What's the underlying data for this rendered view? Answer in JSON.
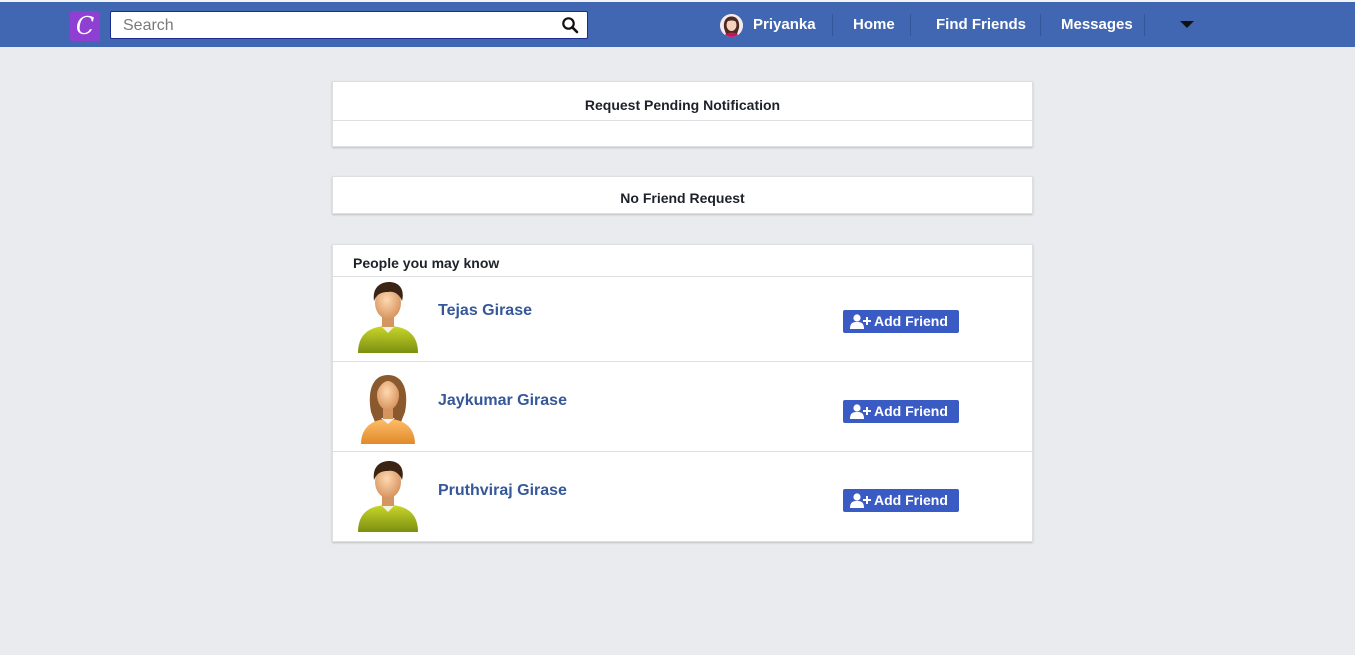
{
  "header": {
    "logo_letter": "C",
    "search_placeholder": "Search",
    "user_name": "Priyanka",
    "nav": [
      "Home",
      "Find Friends",
      "Messages"
    ]
  },
  "pending": {
    "title": "Request Pending Notification"
  },
  "requests": {
    "title": "No Friend Request"
  },
  "suggestions": {
    "title": "People you may know",
    "button_label": "Add Friend",
    "people": [
      {
        "name": "Tejas Girase",
        "avatar": "male-avatar-icon"
      },
      {
        "name": "Jaykumar Girase",
        "avatar": "female-avatar-icon"
      },
      {
        "name": "Pruthviraj Girase",
        "avatar": "male-avatar-icon"
      }
    ]
  },
  "colors": {
    "topbar": "#4267b2",
    "button": "#3b5bc4",
    "name_link": "#365899",
    "page_bg": "#e9ebee"
  }
}
